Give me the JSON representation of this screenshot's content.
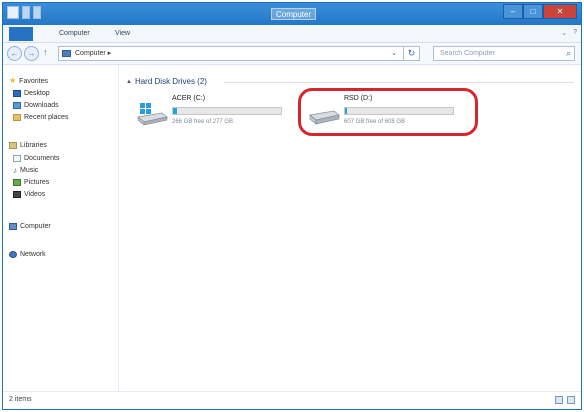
{
  "window": {
    "title": "Computer"
  },
  "ribbon": {
    "file_tab": "",
    "tabs": [
      "Computer",
      "View"
    ],
    "controls": [
      "⌄",
      "?"
    ]
  },
  "address_bar": {
    "back": "←",
    "forward": "→",
    "up": "↑",
    "path": "Computer ▸",
    "dropdown": "⌄",
    "refresh": "↻"
  },
  "search": {
    "placeholder": "Search Computer"
  },
  "sidebar": {
    "favorites_header": "Favorites",
    "favorites": [
      "Desktop",
      "Downloads",
      "Recent places"
    ],
    "libraries_header": "Libraries",
    "libraries": [
      "Documents",
      "Music",
      "Pictures",
      "Videos"
    ],
    "computer": "Computer",
    "network": "Network"
  },
  "content": {
    "group_header": "Hard Disk Drives (2)",
    "group_chevron": "▲",
    "drives": [
      {
        "name": "ACER (C:)",
        "free_text": "266 GB free of 277 GB",
        "used_fraction": 0.04
      },
      {
        "name": "RSD (D:)",
        "free_text": "607 GB free of 608 GB",
        "used_fraction": 0.02
      }
    ]
  },
  "statusbar": {
    "items": "2 items"
  },
  "colors": {
    "highlight": "#d5262e",
    "accent": "#2576c8",
    "drive_fill": "#27a4dd"
  }
}
